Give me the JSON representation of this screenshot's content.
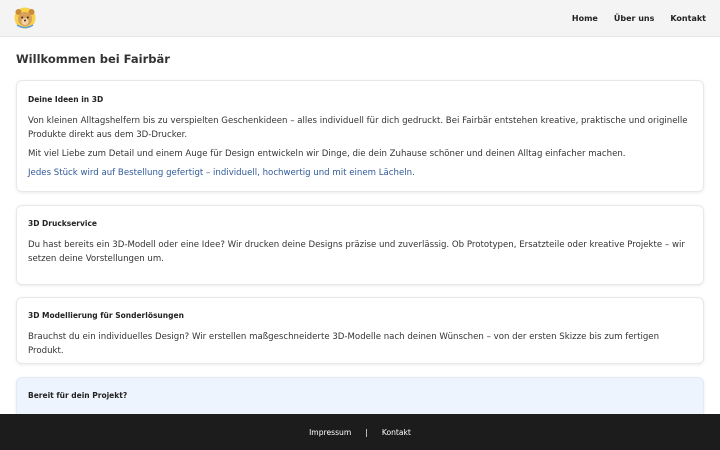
{
  "header": {
    "logo_icon": "bear-logo-icon",
    "nav": [
      {
        "label": "Home"
      },
      {
        "label": "Über uns"
      },
      {
        "label": "Kontakt"
      }
    ]
  },
  "main": {
    "title": "Willkommen bei Fairbär",
    "sections": [
      {
        "title": "Deine Ideen in 3D",
        "paragraphs": [
          "Von kleinen Alltagshelfern bis zu verspielten Geschenkideen – alles individuell für dich gedruckt. Bei Fairbär entstehen kreative, praktische und originelle Produkte direkt aus dem 3D-Drucker.",
          "Mit viel Liebe zum Detail und einem Auge für Design entwickeln wir Dinge, die dein Zuhause schöner und deinen Alltag einfacher machen.",
          "Jedes Stück wird auf Bestellung gefertigt – individuell, hochwertig und mit einem Lächeln."
        ]
      },
      {
        "title": "3D Druckservice",
        "paragraphs": [
          "Du hast bereits ein 3D-Modell oder eine Idee? Wir drucken deine Designs präzise und zuverlässig. Ob Prototypen, Ersatzteile oder kreative Projekte – wir setzen deine Vorstellungen um."
        ]
      },
      {
        "title": "3D Modellierung für Sonderlösungen",
        "paragraphs": [
          "Brauchst du ein individuelles Design? Wir erstellen maßgeschneiderte 3D-Modelle nach deinen Wünschen – von der ersten Skizze bis zum fertigen Produkt."
        ]
      },
      {
        "title": "Bereit für dein Projekt?"
      }
    ]
  },
  "footer": {
    "links": [
      {
        "label": "Impressum"
      },
      {
        "label": "Kontakt"
      }
    ],
    "separator": "|"
  },
  "colors": {
    "accent_text": "#2f5a99",
    "footer_bg": "#1c1c1c",
    "cta_card_bg": "#eef4fd"
  }
}
